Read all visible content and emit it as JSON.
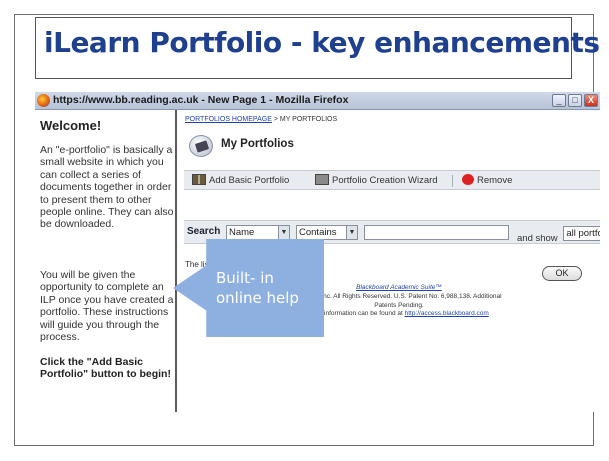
{
  "slide": {
    "title": "iLearn Portfolio  - key enhancements"
  },
  "browser": {
    "window_title": "https://www.bb.reading.ac.uk - New Page 1 - Mozilla Firefox",
    "controls": {
      "minimize": "_",
      "maximize": "□",
      "close": "X"
    }
  },
  "sidebar": {
    "heading": "Welcome!",
    "paragraph1": "An \"e-portfolio\" is basically a small website in which you can collect a series of documents together in order to present them to other people online. They can also be downloaded.",
    "paragraph2": "You will be given the opportunity to complete an ILP once you have created a portfolio. These instructions will guide you through the process.",
    "paragraph3": "Click the \"Add Basic Portfolio\" button to begin!"
  },
  "content": {
    "breadcrumb": {
      "link": "PORTFOLIOS HOMEPAGE",
      "separator": " > ",
      "current": "MY PORTFOLIOS"
    },
    "page_title": "My Portfolios",
    "toolbar": {
      "add_basic": "Add Basic Portfolio",
      "wizard": "Portfolio Creation Wizard",
      "remove": "Remove"
    },
    "search": {
      "label": "Search",
      "field": "Name",
      "operator": "Contains",
      "show_label": "and show",
      "show_value": "all portfoli"
    },
    "list_text": "The lis",
    "ok_button": "OK",
    "footer": {
      "suite": "Blackboard Academic Suite™",
      "line1": "ckboard Inc. All Rights Reserved. U.S. Patent No. 6,988,138. Additional",
      "line2": "Patents Pending.",
      "line3": "bility information can be found at ",
      "link": "http://access.blackboard.com"
    }
  },
  "callout": {
    "line1": "Built- in",
    "line2": "online help",
    "color": "#8eb0e0"
  }
}
